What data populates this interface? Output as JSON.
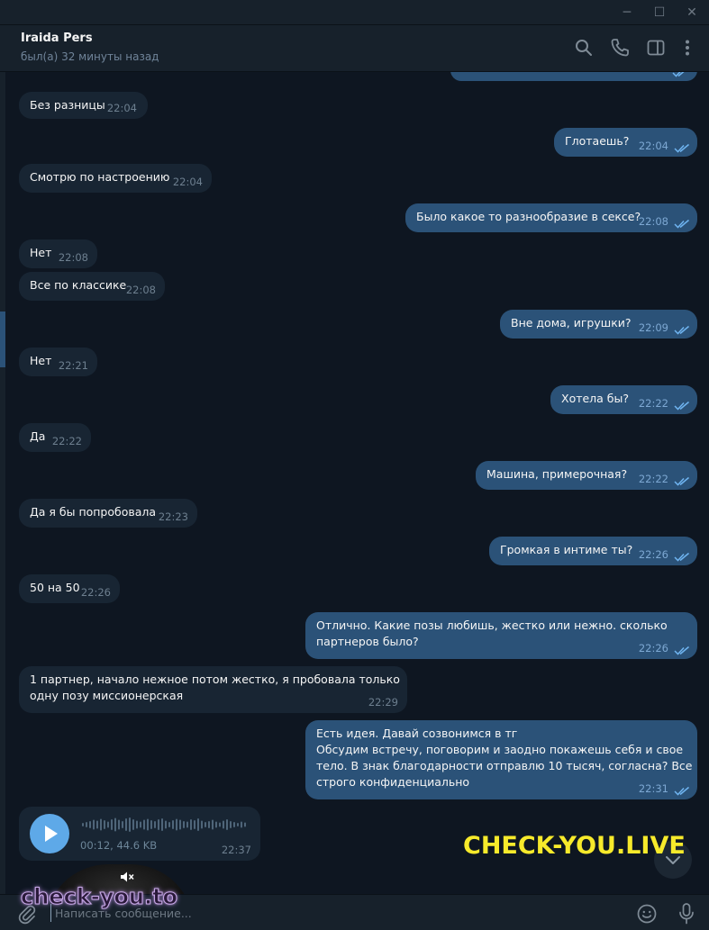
{
  "window": {
    "min_glyph": "─",
    "max_glyph": "☐",
    "close_glyph": "✕"
  },
  "header": {
    "name": "Iraida Pers",
    "status": "был(а) 32 минуты назад",
    "icons": [
      "search-icon",
      "phone-icon",
      "side-panel-icon",
      "more-vertical-icon"
    ]
  },
  "messages": [
    {
      "dir": "in",
      "text": "Без разницы",
      "time": "22:04"
    },
    {
      "dir": "out",
      "text": "Глотаешь?",
      "time": "22:04"
    },
    {
      "dir": "in",
      "text": "Смотрю по настроению",
      "time": "22:04"
    },
    {
      "dir": "out",
      "text": "Было какое то разнообразие в сексе?",
      "time": "22:08"
    },
    {
      "dir": "in",
      "text": "Нет",
      "time": "22:08"
    },
    {
      "dir": "in",
      "text": "Все по классике",
      "time": "22:08"
    },
    {
      "dir": "out",
      "text": "Вне дома, игрушки?",
      "time": "22:09"
    },
    {
      "dir": "in",
      "text": "Нет",
      "time": "22:21"
    },
    {
      "dir": "out",
      "text": "Хотела бы?",
      "time": "22:22"
    },
    {
      "dir": "in",
      "text": "Да",
      "time": "22:22"
    },
    {
      "dir": "out",
      "text": "Машина, примерочная?",
      "time": "22:22"
    },
    {
      "dir": "in",
      "text": "Да я бы попробовала",
      "time": "22:23"
    },
    {
      "dir": "out",
      "text": "Громкая в интиме ты?",
      "time": "22:26"
    },
    {
      "dir": "in",
      "text": "50 на 50",
      "time": "22:26"
    },
    {
      "dir": "out",
      "lines": [
        "Отлично. Какие позы любишь, жестко или нежно. сколько",
        "партнеров было?"
      ],
      "time": "22:26"
    },
    {
      "dir": "in",
      "lines": [
        "1 партнер, начало нежное потом жестко, я пробовала только",
        "одну позу миссионерская"
      ],
      "time": "22:29"
    },
    {
      "dir": "out",
      "lines": [
        "Есть идея. Давай созвонимся в тг",
        "Обсудим встречу, поговорим и заодно покажешь себя и свое",
        "тело. В знак благодарности отправлю 10 тысяч, согласна? Все",
        "строго конфиденциально"
      ],
      "time": "22:31"
    }
  ],
  "voice_message": {
    "duration": "00:12",
    "size": "44.6 KB",
    "meta": "00:12, 44.6 KB",
    "time": "22:37"
  },
  "composer": {
    "placeholder": "Написать сообщение..."
  },
  "watermarks": {
    "yellow": "CHECK-YOU.LIVE",
    "purple": "check-you.to"
  },
  "colors": {
    "bg": "#0e1621",
    "incoming": "#182533",
    "outgoing": "#2b5278",
    "accent": "#5ea9e8",
    "watermark_yellow": "#f7ea2b"
  }
}
